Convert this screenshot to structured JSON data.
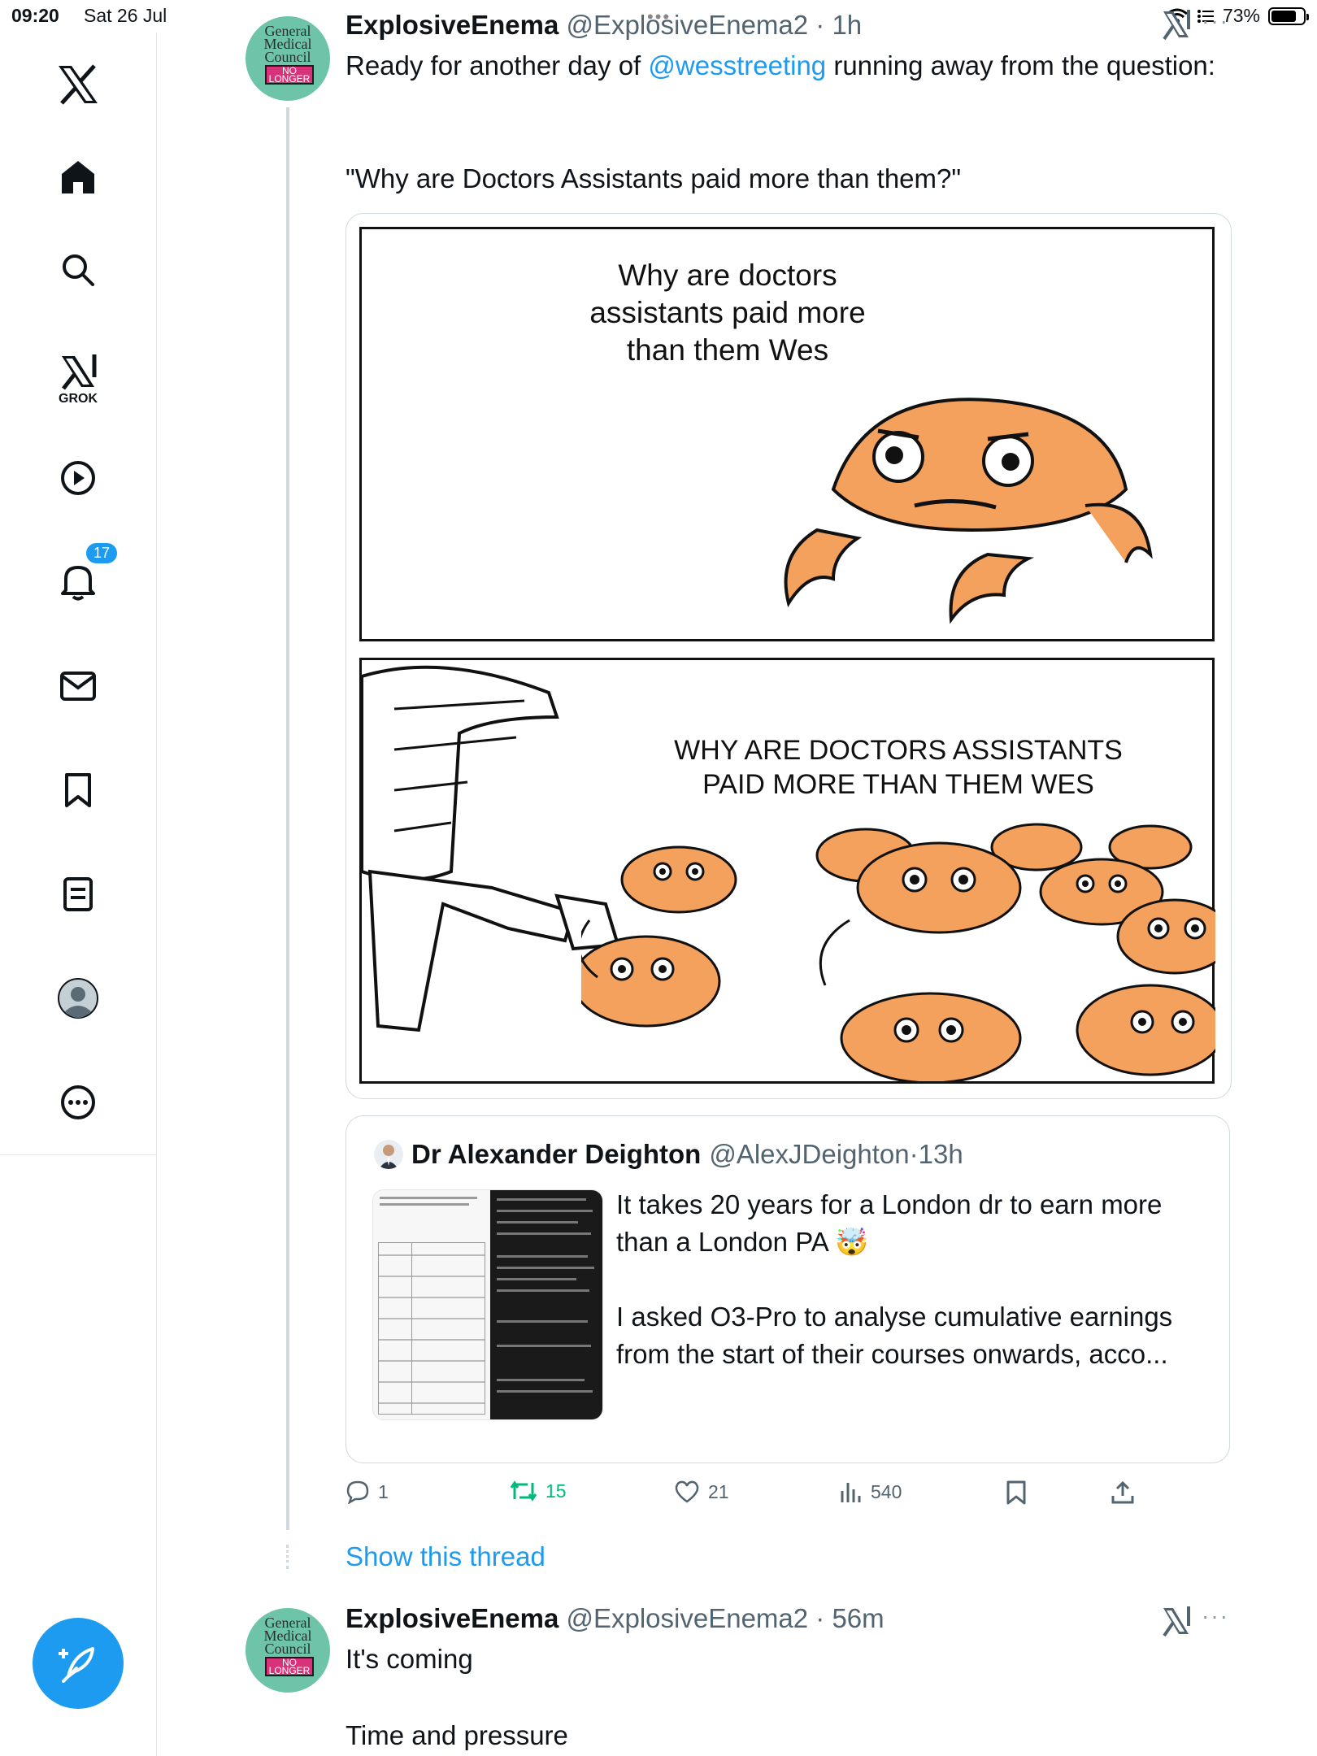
{
  "status_bar": {
    "time": "09:20",
    "date": "Sat 26 Jul",
    "battery": "73%"
  },
  "sidebar": {
    "items": [
      {
        "id": "x-logo",
        "label": ""
      },
      {
        "id": "home",
        "label": ""
      },
      {
        "id": "search",
        "label": ""
      },
      {
        "id": "grok",
        "label": "GROK"
      },
      {
        "id": "video",
        "label": ""
      },
      {
        "id": "notifications",
        "label": "",
        "badge": "17"
      },
      {
        "id": "messages",
        "label": ""
      },
      {
        "id": "bookmarks",
        "label": ""
      },
      {
        "id": "lists",
        "label": ""
      },
      {
        "id": "profile",
        "label": ""
      },
      {
        "id": "more",
        "label": ""
      }
    ]
  },
  "avatar_text": {
    "line1": "General",
    "line2": "Medical",
    "line3": "Council",
    "ban1": "NO",
    "ban2": "LONGER"
  },
  "tweet1": {
    "name": "ExplosiveEnema",
    "handle": "@ExplosiveEnema2",
    "time": "1h",
    "text_before_mention": "Ready for another day of ",
    "mention": "@wesstreeting",
    "text_after_mention": " running away from the question:",
    "text_quote": "\"Why are Doctors Assistants paid more than them?\"",
    "meme_top": "Why are doctors assistants paid more than them Wes",
    "meme_bottom": "WHY ARE DOCTORS ASSISTANTS PAID MORE THAN THEM WES",
    "quote": {
      "name": "Dr Alexander Deighton",
      "handle": "@AlexJDeighton",
      "time": "13h",
      "text1": "It takes 20 years for a London dr to earn more than a London PA 🤯",
      "text2": "I asked O3-Pro to analyse cumulative earnings from the start of their courses onwards, acco..."
    },
    "actions": {
      "replies": "1",
      "reposts": "15",
      "likes": "21",
      "views": "540"
    }
  },
  "show_thread": "Show this thread",
  "tweet2": {
    "name": "ExplosiveEnema",
    "handle": "@ExplosiveEnema2",
    "time": "56m",
    "line1": "It's coming",
    "line2": "Time and pressure"
  },
  "colors": {
    "accent": "#1d9bf0",
    "repost": "#00ba7c",
    "muted": "#536471",
    "crab": "#f4a15d"
  }
}
